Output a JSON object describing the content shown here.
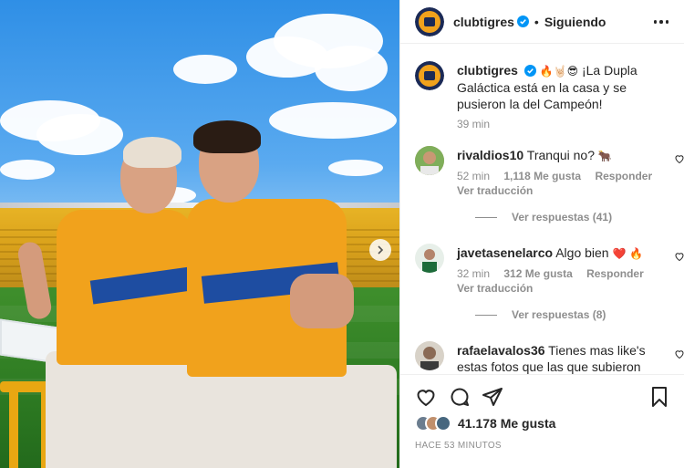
{
  "header": {
    "username": "clubtigres",
    "separator": "•",
    "follow_status": "Siguiendo",
    "verified_icon": "verified-badge-icon",
    "more_icon": "more-options-icon"
  },
  "caption": {
    "username": "clubtigres",
    "emojis": "🔥🤘🏻😎",
    "text": "¡La Dupla Galáctica está en la casa y se pusieron la del Campeón!",
    "time": "39 min"
  },
  "comments": [
    {
      "username": "rivaldios10",
      "text": "Tranqui no?",
      "emoji": "🐂",
      "time": "52 min",
      "likes": "1,118 Me gusta",
      "reply_label": "Responder",
      "translate_label": "Ver traducción",
      "replies_label": "Ver respuestas (41)"
    },
    {
      "username": "javetasenelarco",
      "text": "Algo bien",
      "emoji": "❤️ 🔥",
      "time": "32 min",
      "likes": "312 Me gusta",
      "reply_label": "Responder",
      "translate_label": "Ver traducción",
      "replies_label": "Ver respuestas (8)"
    },
    {
      "username": "rafaelavalos36",
      "text": "Tienes mas like's estas fotos que las que subieron",
      "emoji": "",
      "time": "",
      "likes": "",
      "reply_label": "",
      "translate_label": "",
      "replies_label": ""
    }
  ],
  "actions": {
    "like_icon": "heart-icon",
    "comment_icon": "comment-icon",
    "share_icon": "share-icon",
    "save_icon": "bookmark-icon",
    "likes_count": "41.178 Me gusta",
    "posted_ago": "HACE 53 MINUTOS"
  },
  "colors": {
    "accent_orange": "#f1a21c",
    "brand_blue": "#1e4da1",
    "verified_blue": "#0095f6",
    "muted_text": "#8e8e8e"
  }
}
